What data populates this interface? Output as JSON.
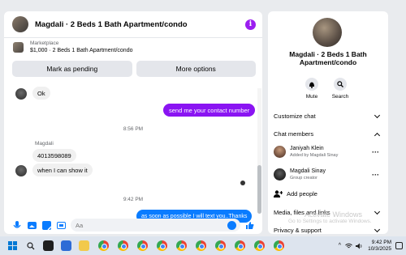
{
  "chat": {
    "title": "Magdali · 2 Beds 1 Bath Apartment/condo",
    "listing_source": "Marketplace",
    "listing_desc": "$1,000 · 2 Beds 1 Bath Apartment/condo",
    "actions": [
      "Mark as pending",
      "More options"
    ],
    "messages": {
      "m1": "Ok",
      "m2": "send me your contact number",
      "ts1": "8:56 PM",
      "sender": "Magdali",
      "m3": "4013598089",
      "m4": "when I can show it",
      "ts2": "9:42 PM",
      "m5": "as soon as possible I will text you..Thanks"
    },
    "composer_placeholder": "Aa"
  },
  "side": {
    "title": "Magdali · 2 Beds 1 Bath Apartment/condo",
    "mute": "Mute",
    "search": "Search",
    "customize": "Customize chat",
    "members_header": "Chat members",
    "members": [
      {
        "name": "Janiyah Klein",
        "sub": "Added by Magdali Sinay"
      },
      {
        "name": "Magdali Sinay",
        "sub": "Group creator"
      }
    ],
    "add_people": "Add people",
    "media": "Media, files and links",
    "privacy": "Privacy & support",
    "watermark_title": "Activate Windows",
    "watermark_sub": "Go to Settings to activate Windows."
  },
  "taskbar": {
    "time": "9:42 PM",
    "date": "10/3/2025"
  },
  "colors": {
    "accent_purple": "#8a14f2",
    "accent_blue": "#0a7cff"
  }
}
